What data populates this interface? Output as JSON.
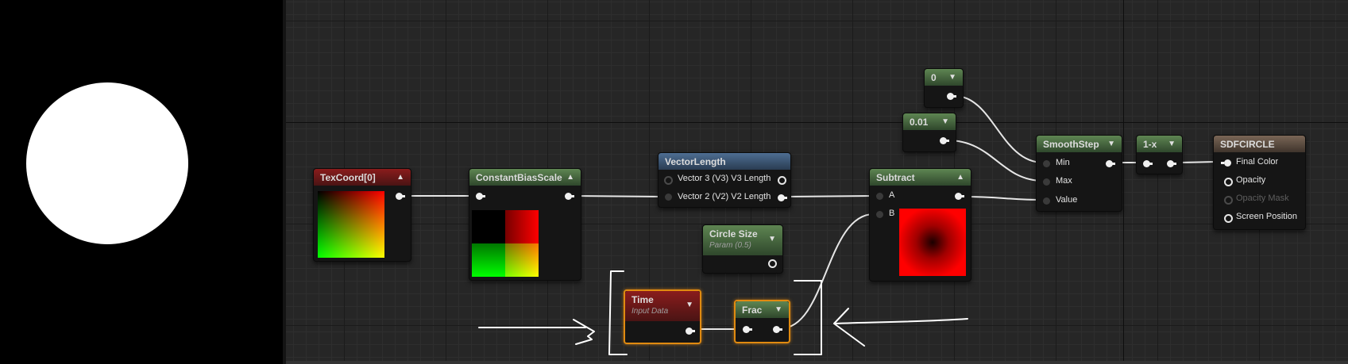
{
  "nodes": {
    "texcoord": {
      "title": "TexCoord[0]"
    },
    "cbs": {
      "title": "ConstantBiasScale"
    },
    "vlen": {
      "title": "VectorLength",
      "pin_v3": "Vector 3 (V3) V3 Length",
      "pin_v2": "Vector 2 (V2) V2 Length"
    },
    "circle_size": {
      "title": "Circle Size",
      "subtitle": "Param (0.5)"
    },
    "time": {
      "title": "Time",
      "subtitle": "Input Data"
    },
    "frac": {
      "title": "Frac"
    },
    "subtract": {
      "title": "Subtract",
      "pin_a": "A",
      "pin_b": "B"
    },
    "const0": {
      "title": "0"
    },
    "const001": {
      "title": "0.01"
    },
    "smoothstep": {
      "title": "SmoothStep",
      "pin_min": "Min",
      "pin_max": "Max",
      "pin_value": "Value"
    },
    "oneminus": {
      "title": "1-x"
    },
    "sdfcircle": {
      "title": "SDFCIRCLE",
      "pin_final_color": "Final Color",
      "pin_opacity": "Opacity",
      "pin_opacity_mask": "Opacity Mask",
      "pin_screen_position": "Screen Position"
    }
  },
  "icons": {
    "collapse": "chevron-up-icon",
    "expand": "chevron-down-icon"
  },
  "colors": {
    "node_header_red": "#8a1c1c",
    "node_header_green": "#5e8552",
    "node_header_blue": "#4e6e93",
    "node_header_brown": "#7a6656",
    "selection_outline": "#e08a10",
    "wire": "#e6e6e6",
    "annotation": "#ffffff"
  }
}
